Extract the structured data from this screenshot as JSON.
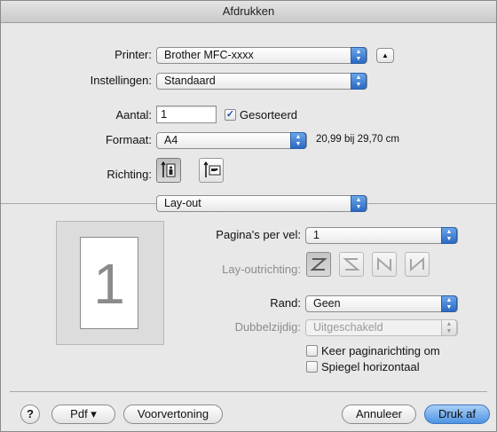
{
  "window": {
    "title": "Afdrukken"
  },
  "printer": {
    "label": "Printer:",
    "value": "Brother MFC-xxxx"
  },
  "presets": {
    "label": "Instellingen:",
    "value": "Standaard"
  },
  "copies": {
    "label": "Aantal:",
    "value": "1",
    "collated_label": "Gesorteerd",
    "collated": true
  },
  "paper": {
    "label": "Formaat:",
    "value": "A4",
    "size_text": "20,99 bij 29,70 cm"
  },
  "orientation": {
    "label": "Richting:",
    "selected": "portrait"
  },
  "section": {
    "value": "Lay-out"
  },
  "preview": {
    "page_number": "1"
  },
  "layout": {
    "pages_per_sheet_label": "Pagina's per vel:",
    "pages_per_sheet_value": "1",
    "direction_label": "Lay-outrichting:",
    "border_label": "Rand:",
    "border_value": "Geen",
    "duplex_label": "Dubbelzijdig:",
    "duplex_value": "Uitgeschakeld",
    "reverse_label": "Keer paginarichting om",
    "mirror_label": "Spiegel horizontaal"
  },
  "footer": {
    "help": "?",
    "pdf_label": "Pdf ▾",
    "preview_label": "Voorvertoning",
    "cancel_label": "Annuleer",
    "print_label": "Druk af"
  },
  "colors": {
    "accent": "#4e93e3",
    "popup_arrow": "#2b69c4"
  }
}
